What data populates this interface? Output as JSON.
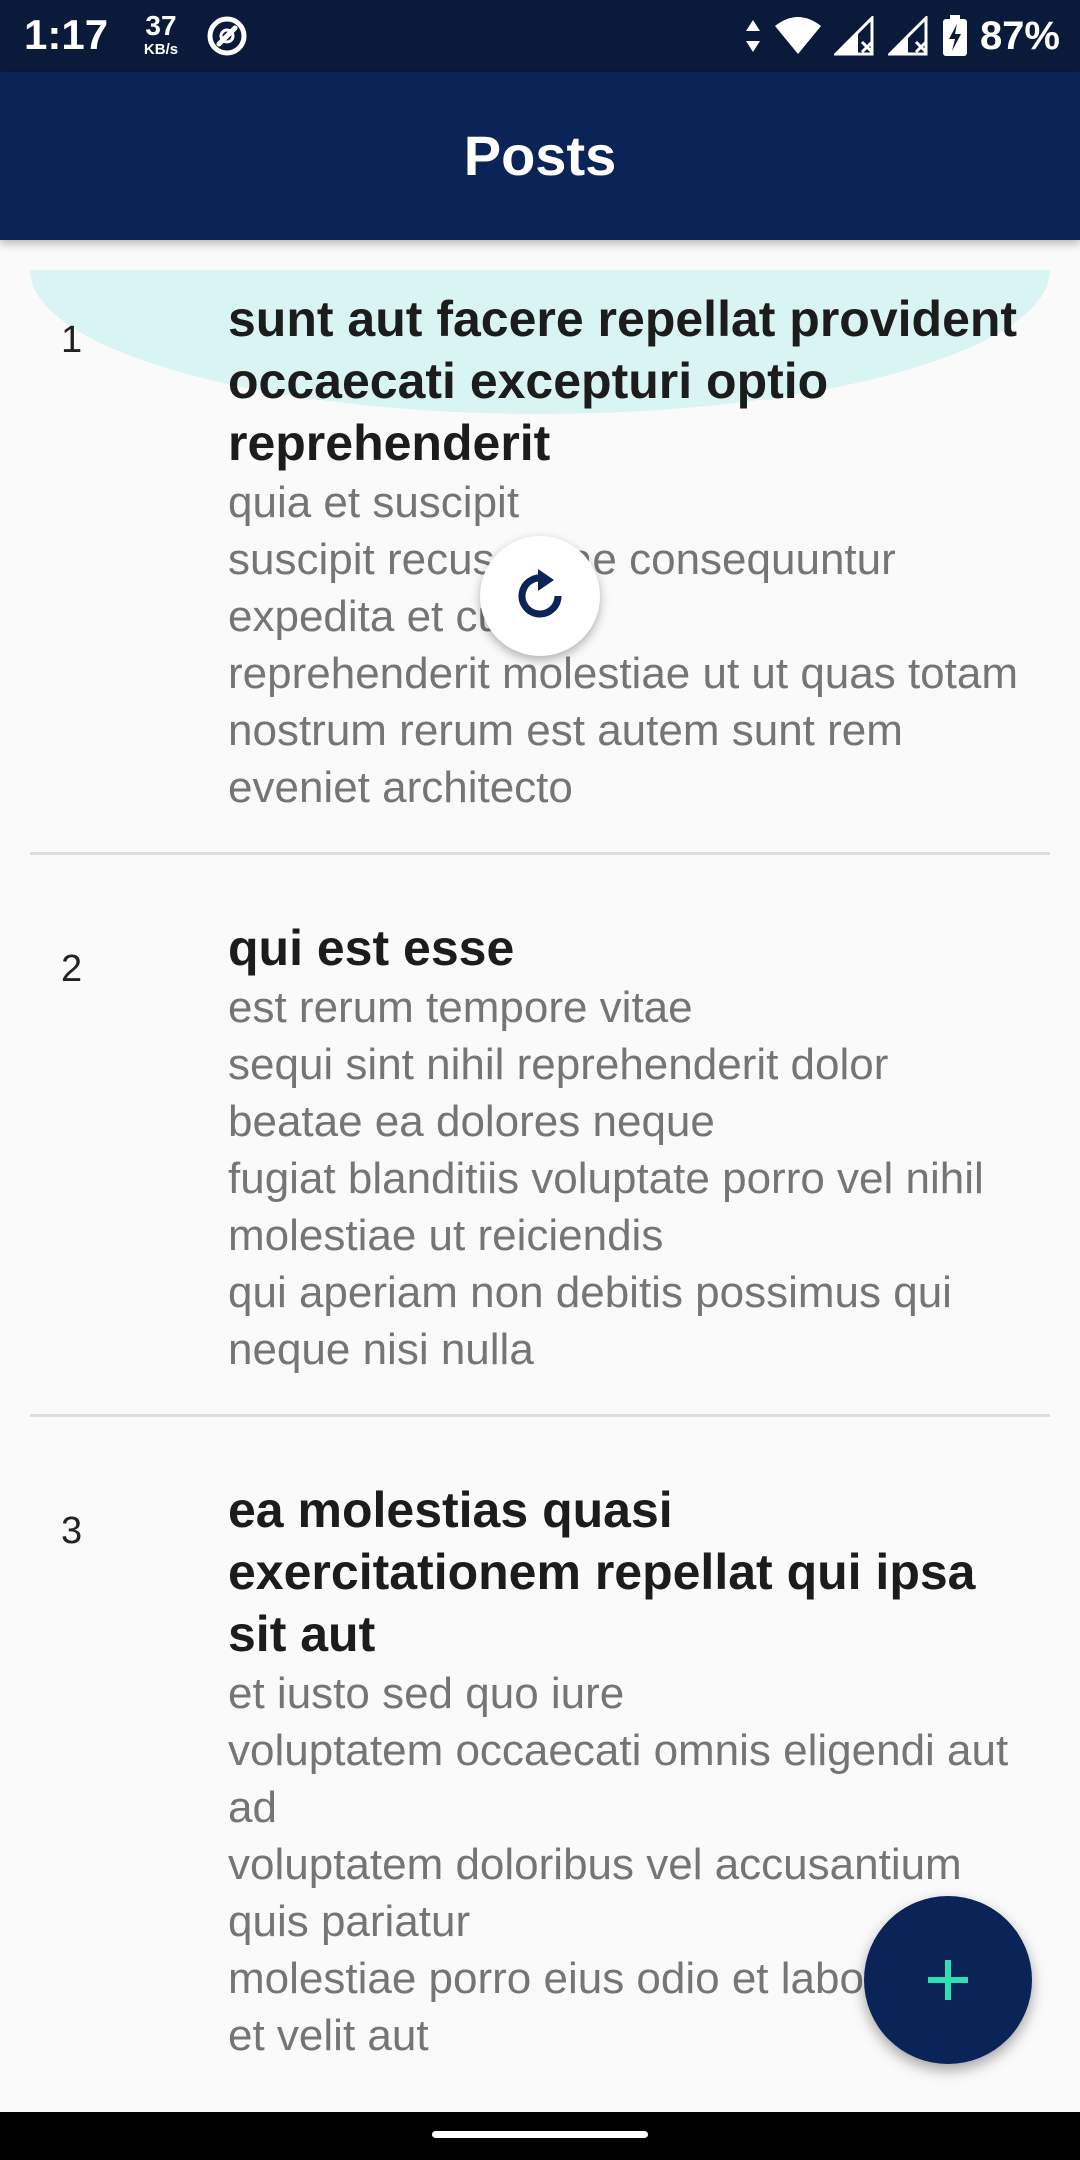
{
  "status_bar": {
    "time": "1:17",
    "net_speed_value": "37",
    "net_speed_unit": "KB/s",
    "battery_percent": "87%",
    "icons": [
      "data-saver-icon",
      "data-arrows-icon",
      "wifi-icon",
      "signal-icon",
      "signal-icon",
      "battery-charging-icon"
    ]
  },
  "app_bar": {
    "title": "Posts"
  },
  "posts": [
    {
      "id": "1",
      "title": "sunt aut facere repellat provident occaecati excepturi optio reprehenderit",
      "body": "quia et suscipit\nsuscipit recusandae consequuntur expedita et cum\nreprehenderit molestiae ut ut quas totam\nnostrum rerum est autem sunt rem eveniet architecto"
    },
    {
      "id": "2",
      "title": "qui est esse",
      "body": "est rerum tempore vitae\nsequi sint nihil reprehenderit dolor beatae ea dolores neque\nfugiat blanditiis voluptate porro vel nihil molestiae ut reiciendis\nqui aperiam non debitis possimus qui neque nisi nulla"
    },
    {
      "id": "3",
      "title": "ea molestias quasi exercitationem repellat qui ipsa sit aut",
      "body": "et iusto sed quo iure\nvoluptatem occaecati omnis eligendi aut ad\nvoluptatem doloribus vel accusantium quis pariatur\nmolestiae porro eius odio et labore\net velit aut"
    }
  ],
  "refresh_indicator": {
    "icon": "refresh-icon"
  },
  "fab": {
    "icon": "add-icon"
  },
  "colors": {
    "status_bar": "#0a1a3a",
    "app_bar": "#0a2457",
    "fab_background": "#0a2457",
    "fab_icon": "#2de0b5",
    "overscroll_glow": "#d8f5f3",
    "body_text": "#757575",
    "divider": "#dddddd"
  }
}
